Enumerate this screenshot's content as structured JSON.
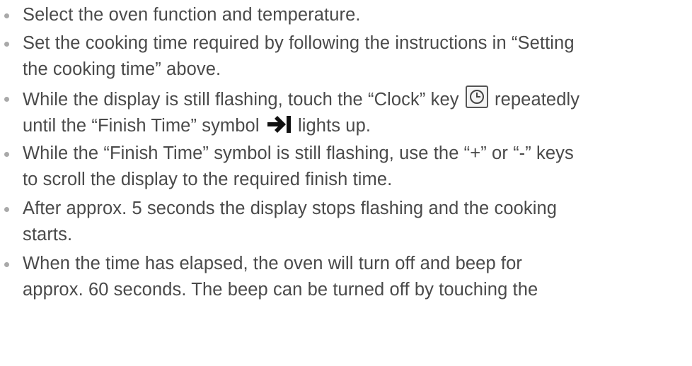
{
  "instructions": [
    {
      "text": "Select the oven function and temperature."
    },
    {
      "line1": "Set the cooking time required by following the instructions in “Setting",
      "line2": "the cooking time” above."
    },
    {
      "before_icon": "While the display is still flashing, touch the “Clock” key",
      "after_icon": "repeatedly",
      "line2_before_icon": "until the “Finish Time” symbol",
      "line2_after_icon": "lights up."
    },
    {
      "line1": "While the “Finish Time” symbol is still flashing, use the “+” or “-” keys",
      "line2": "to scroll the display to the required finish time."
    },
    {
      "line1": "After approx. 5 seconds the display stops flashing and the cooking",
      "line2": "starts."
    },
    {
      "line1": "When the time has elapsed, the oven will turn off and beep for",
      "line2": "approx. 60 seconds.  The beep can be turned off by touching the"
    }
  ],
  "icons": {
    "bullet": "bullet-dot",
    "clock_key": "clock-key-icon",
    "finish_time": "finish-time-arrow-icon"
  },
  "colors": {
    "text": "#4a4a4a",
    "bullet": "#a9a9a9"
  }
}
